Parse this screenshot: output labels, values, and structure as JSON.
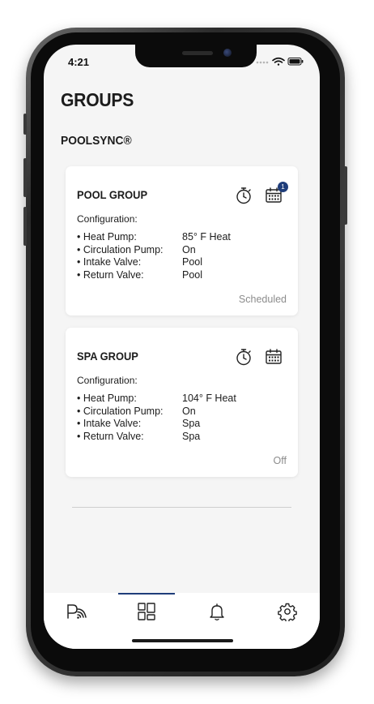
{
  "status_bar": {
    "time": "4:21"
  },
  "page_title": "GROUPS",
  "section_title": "POOLSYNC®",
  "groups": [
    {
      "title": "POOL GROUP",
      "config_label": "Configuration:",
      "items": [
        {
          "key": "• Heat Pump:",
          "value": "85° F Heat"
        },
        {
          "key": "• Circulation Pump:",
          "value": "On"
        },
        {
          "key": "• Intake Valve:",
          "value": "Pool"
        },
        {
          "key": "• Return Valve:",
          "value": "Pool"
        }
      ],
      "status": "Scheduled",
      "schedule_badge": "1"
    },
    {
      "title": "SPA GROUP",
      "config_label": "Configuration:",
      "items": [
        {
          "key": "• Heat Pump:",
          "value": "104° F Heat"
        },
        {
          "key": "• Circulation Pump:",
          "value": "On"
        },
        {
          "key": "• Intake Valve:",
          "value": "Spa"
        },
        {
          "key": "• Return Valve:",
          "value": "Spa"
        }
      ],
      "status": "Off"
    }
  ],
  "tabs": [
    {
      "icon": "poolsync-logo-icon",
      "active": false
    },
    {
      "icon": "groups-grid-icon",
      "active": true
    },
    {
      "icon": "bell-icon",
      "active": false
    },
    {
      "icon": "gear-icon",
      "active": false
    }
  ],
  "colors": {
    "accent": "#1f3d7a",
    "background": "#f5f5f5",
    "card": "#ffffff",
    "status_text": "#8c8c8c"
  }
}
